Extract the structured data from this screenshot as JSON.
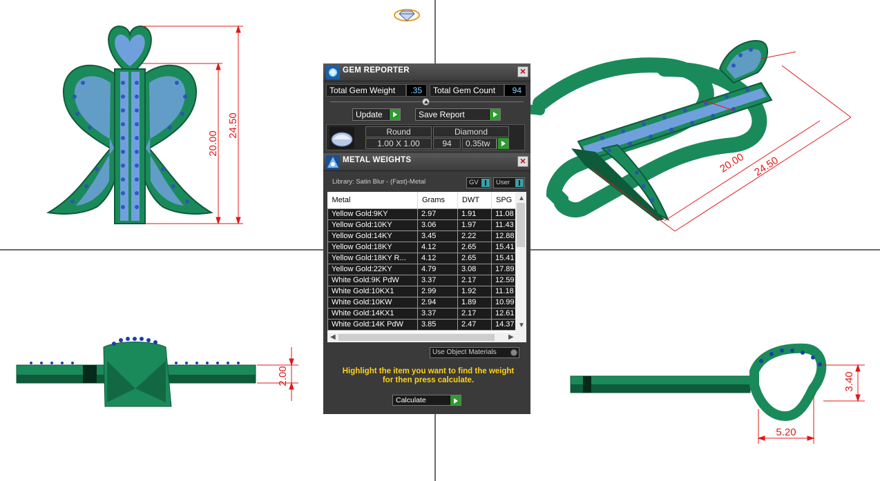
{
  "gem_reporter": {
    "title": "GEM REPORTER",
    "close_label": "×",
    "total_gem_weight_label": "Total Gem Weight",
    "total_gem_weight_value": ".35",
    "total_gem_count_label": "Total Gem Count",
    "total_gem_count_value": "94",
    "update_label": "Update",
    "save_report_label": "Save Report",
    "gem": {
      "shape": "Round",
      "material": "Diamond",
      "size": "1.00 X 1.00",
      "count": "94",
      "weight": "0.35tw"
    }
  },
  "metal_weights": {
    "title": "METAL WEIGHTS",
    "close_label": "×",
    "library": "Library: Satin Blur - (Fast)-Metal",
    "gv_label": "GV",
    "user_label": "User",
    "columns": [
      "Metal",
      "Grams",
      "DWT",
      "SPG"
    ],
    "rows": [
      [
        "Yellow Gold:9KY",
        "2.97",
        "1.91",
        "11.08"
      ],
      [
        "Yellow Gold:10KY",
        "3.06",
        "1.97",
        "11.43"
      ],
      [
        "Yellow Gold:14KY",
        "3.45",
        "2.22",
        "12.88"
      ],
      [
        "Yellow Gold:18KY",
        "4.12",
        "2.65",
        "15.41"
      ],
      [
        "Yellow Gold:18KY R...",
        "4.12",
        "2.65",
        "15.41"
      ],
      [
        "Yellow Gold:22KY",
        "4.79",
        "3.08",
        "17.89"
      ],
      [
        "White Gold:9K PdW",
        "3.37",
        "2.17",
        "12.59"
      ],
      [
        "White Gold:10KX1",
        "2.99",
        "1.92",
        "11.18"
      ],
      [
        "White Gold:10KW",
        "2.94",
        "1.89",
        "10.99"
      ],
      [
        "White Gold:14KX1",
        "3.37",
        "2.17",
        "12.61"
      ],
      [
        "White Gold:14K PdW",
        "3.85",
        "2.47",
        "14.37"
      ]
    ],
    "use_object_materials_label": "Use Object Materials",
    "hint_line1": "Highlight the item you want to find the weight",
    "hint_line2": "for then press calculate.",
    "calculate_label": "Calculate"
  },
  "dimensions": {
    "front_height_outer": "24.50",
    "front_height_inner": "20.00",
    "iso_inner": "20.00",
    "iso_outer": "24.50",
    "side_thickness": "2.00",
    "bail_height": "3.40",
    "bail_width": "5.20"
  },
  "colors": {
    "metal_green": "#1b8a5a",
    "metal_dark": "#0f5a3a",
    "gem_light": "#7fb0e8",
    "gem_dark": "#1a3fa8",
    "dimension_red": "#e01818",
    "panel_bg": "#3a3a3a",
    "hint_yellow": "#ffd21a"
  }
}
